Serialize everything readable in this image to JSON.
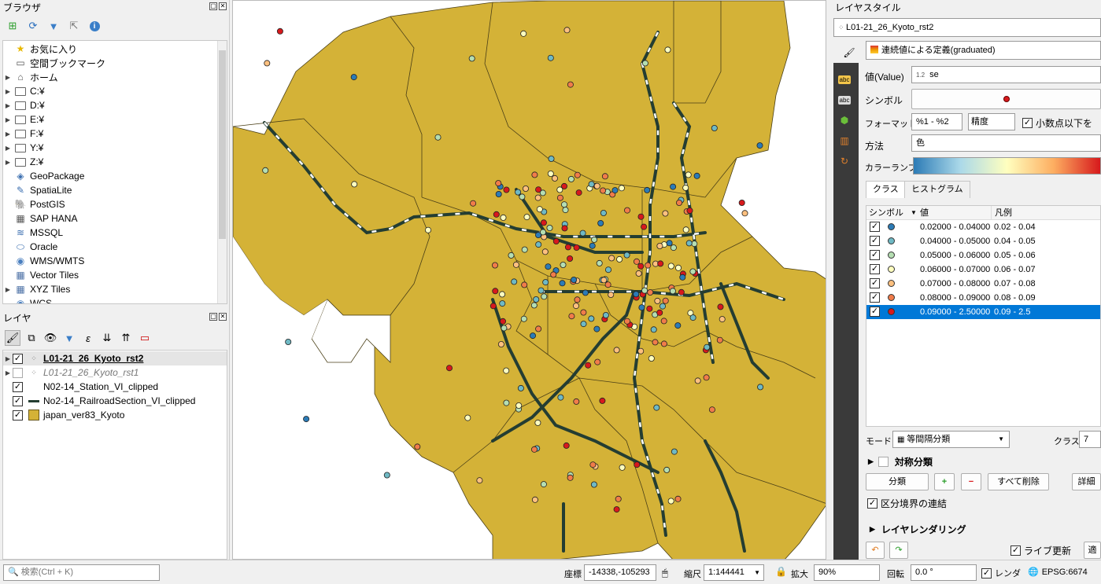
{
  "browser_panel": {
    "title": "ブラウザ",
    "items": [
      {
        "label": "お気に入り",
        "icon": "star-icon",
        "expand": false
      },
      {
        "label": "空間ブックマーク",
        "icon": "bookmark-folder-icon",
        "expand": false
      },
      {
        "label": "ホーム",
        "icon": "home-folder-icon",
        "expand": true
      },
      {
        "label": "C:¥",
        "icon": "folder-icon",
        "expand": true
      },
      {
        "label": "D:¥",
        "icon": "folder-icon",
        "expand": true
      },
      {
        "label": "E:¥",
        "icon": "folder-icon",
        "expand": true
      },
      {
        "label": "F:¥",
        "icon": "folder-icon",
        "expand": true
      },
      {
        "label": "Y:¥",
        "icon": "folder-icon",
        "expand": true
      },
      {
        "label": "Z:¥",
        "icon": "folder-icon",
        "expand": true
      },
      {
        "label": "GeoPackage",
        "icon": "geopackage-icon",
        "expand": false
      },
      {
        "label": "SpatiaLite",
        "icon": "spatialite-icon",
        "expand": false
      },
      {
        "label": "PostGIS",
        "icon": "postgis-icon",
        "expand": false
      },
      {
        "label": "SAP HANA",
        "icon": "sap-hana-icon",
        "expand": false
      },
      {
        "label": "MSSQL",
        "icon": "mssql-icon",
        "expand": false
      },
      {
        "label": "Oracle",
        "icon": "oracle-icon",
        "expand": false
      },
      {
        "label": "WMS/WMTS",
        "icon": "globe-icon",
        "expand": false
      },
      {
        "label": "Vector Tiles",
        "icon": "grid-icon",
        "expand": false
      },
      {
        "label": "XYZ Tiles",
        "icon": "grid-icon",
        "expand": true
      },
      {
        "label": "WCS",
        "icon": "globe-icon",
        "expand": false
      }
    ]
  },
  "layers_panel": {
    "title": "レイヤ",
    "layers": [
      {
        "label": "L01-21_26_Kyoto_rst2",
        "checked": true,
        "style": "bold",
        "expand": true,
        "icon": "point-layer-icon"
      },
      {
        "label": "L01-21_26_Kyoto_rst1",
        "checked": false,
        "style": "italic",
        "expand": true,
        "icon": "point-layer-icon"
      },
      {
        "label": "N02-14_Station_VI_clipped",
        "checked": true,
        "style": "normal",
        "expand": false,
        "icon": "none"
      },
      {
        "label": "No2-14_RailroadSection_VI_clipped",
        "checked": true,
        "style": "normal",
        "expand": false,
        "icon": "line-layer-icon"
      },
      {
        "label": "japan_ver83_Kyoto",
        "checked": true,
        "style": "normal",
        "expand": false,
        "icon": "polygon-layer-icon"
      }
    ]
  },
  "style_panel": {
    "title": "レイヤスタイル",
    "layer_select": "L01-21_26_Kyoto_rst2",
    "renderer": "連続値による定義(graduated)",
    "value_label": "値(Value)",
    "value_type": "1.2",
    "value_field": "se",
    "symbol_label": "シンボル",
    "format_label": "フォーマット",
    "format_value": "%1 - %2",
    "precision_label": "精度",
    "trim_label": "小数点以下を",
    "method_label": "方法",
    "method_value": "色",
    "ramp_label": "カラーランプ",
    "tabs": [
      "クラス",
      "ヒストグラム"
    ],
    "columns": {
      "symbol": "シンボル",
      "value": "値",
      "legend": "凡例"
    },
    "classes": [
      {
        "value": "0.02000 - 0.04000",
        "legend": "0.02 - 0.04",
        "color": "#2c7bb6"
      },
      {
        "value": "0.04000 - 0.05000",
        "legend": "0.04 - 0.05",
        "color": "#6fb9c4"
      },
      {
        "value": "0.05000 - 0.06000",
        "legend": "0.05 - 0.06",
        "color": "#b5deb2"
      },
      {
        "value": "0.06000 - 0.07000",
        "legend": "0.06 - 0.07",
        "color": "#ffffbf"
      },
      {
        "value": "0.07000 - 0.08000",
        "legend": "0.07 - 0.08",
        "color": "#fdc07f"
      },
      {
        "value": "0.08000 - 0.09000",
        "legend": "0.08 - 0.09",
        "color": "#f07c4a"
      },
      {
        "value": "0.09000 - 2.50000",
        "legend": "0.09 - 2.5",
        "color": "#d7191c"
      }
    ],
    "mode_label": "モード",
    "mode_value": "等間隔分類",
    "classes_label": "クラス",
    "classes_count": "7",
    "symmetric_label": "対称分類",
    "classify_button": "分類",
    "delete_all_button": "すべて削除",
    "advanced_button": "詳細",
    "link_label": "区分境界の連結",
    "rendering_label": "レイヤレンダリング",
    "live_update_label": "ライブ更新",
    "apply_button": "適"
  },
  "status_bar": {
    "search_placeholder": "検索(Ctrl + K)",
    "coord_label": "座標",
    "coord_value": "-14338,-105293",
    "scale_label": "縮尺",
    "scale_value": "1:144441",
    "zoom_label": "拡大",
    "zoom_value": "90%",
    "rotation_label": "回転",
    "rotation_value": "0.0 °",
    "render_label": "レンダ",
    "crs": "EPSG:6674"
  }
}
